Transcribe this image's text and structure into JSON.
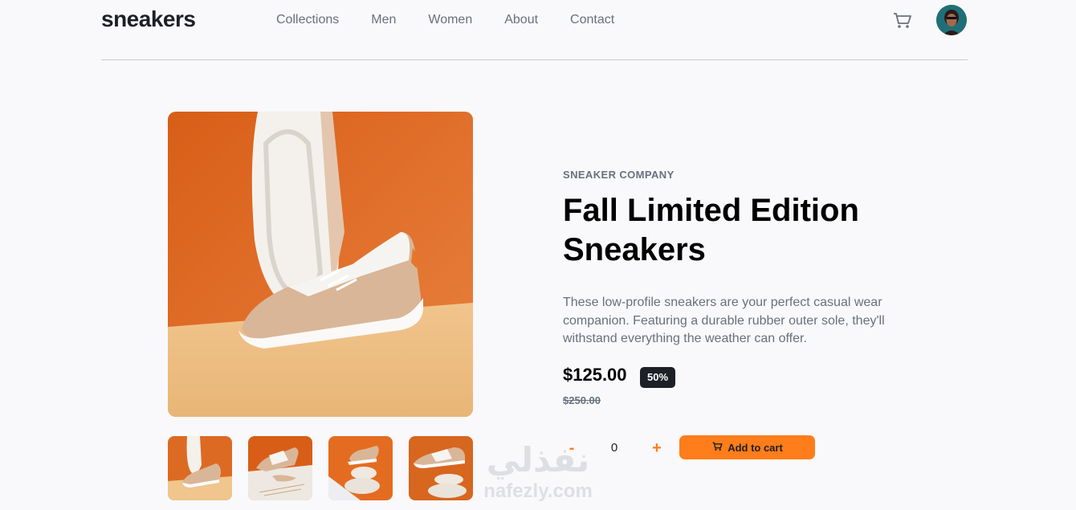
{
  "header": {
    "logo": "sneakers",
    "nav": [
      "Collections",
      "Men",
      "Women",
      "About",
      "Contact"
    ],
    "cart_icon": "cart-icon",
    "avatar_icon": "user-avatar"
  },
  "product": {
    "company": "SNEAKER COMPANY",
    "title": "Fall Limited Edition Sneakers",
    "description": "These low-profile sneakers are your perfect casual wear companion. Featuring a durable rubber outer sole, they'll withstand everything the weather can offer.",
    "price": "$125.00",
    "discount": "50%",
    "old_price": "$250.00",
    "quantity": "0",
    "minus_label": "-",
    "plus_label": "+",
    "add_to_cart_label": "Add to cart"
  },
  "gallery": {
    "main_image": "product-photo-1",
    "thumbnails": [
      "thumbnail-1",
      "thumbnail-2",
      "thumbnail-3",
      "thumbnail-4"
    ]
  },
  "watermark": {
    "arabic": "نفذلي",
    "latin": "nafezly.com"
  },
  "colors": {
    "accent": "#ff7d1a",
    "dark": "#1d2026",
    "muted": "#69707d",
    "background": "#f9f9fb"
  }
}
